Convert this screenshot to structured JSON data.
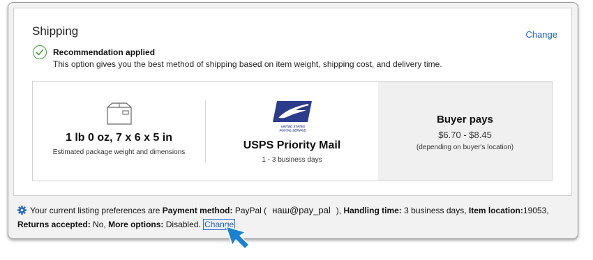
{
  "shipping": {
    "title": "Shipping",
    "change_label": "Change",
    "recommendation": {
      "title": "Recommendation applied",
      "description": "This option gives you the best method of shipping based on item weight, shipping cost, and delivery time."
    },
    "package": {
      "icon": "package-box-icon",
      "dimensions": "1 lb 0 oz, 7 x 6 x 5 in",
      "caption": "Estimated package weight and dimensions"
    },
    "service": {
      "logo": "usps-eagle-logo",
      "logo_text": "UNITED STATES POSTAL SERVICE",
      "name": "USPS Priority Mail",
      "delivery": "1 - 3 business days"
    },
    "buyer": {
      "title": "Buyer pays",
      "price_range": "$6.70 - $8.45",
      "note": "(depending on buyer's location)"
    }
  },
  "preferences": {
    "icon": "gear-icon",
    "intro": "Your current listing preferences are",
    "payment_label": "Payment method:",
    "payment_value": "PayPal (",
    "email": "наш@pay_pal",
    "payment_close": "),",
    "handling_label": "Handling time:",
    "handling_value": "3 business days,",
    "location_label": "Item location:",
    "location_value": "19053,",
    "returns_label": "Returns accepted:",
    "returns_value": "No,",
    "more_label": "More options:",
    "more_value": "Disabled.",
    "change_label": "Change"
  },
  "colors": {
    "link": "#1c5fb8",
    "check": "#3f9a33",
    "usps_blue": "#2c3c8c",
    "pointer": "#1a82d0"
  }
}
